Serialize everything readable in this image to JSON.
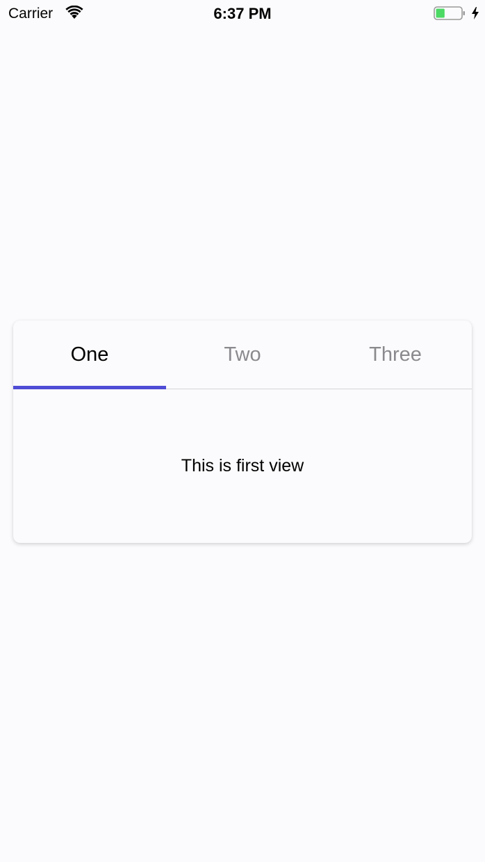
{
  "status_bar": {
    "carrier": "Carrier",
    "time": "6:37 PM",
    "battery_level": 0.35,
    "charging": true,
    "icons": [
      "wifi-icon",
      "battery-icon",
      "charging-bolt-icon"
    ]
  },
  "tabs": {
    "items": [
      {
        "label": "One",
        "active": true
      },
      {
        "label": "Two",
        "active": false
      },
      {
        "label": "Three",
        "active": false
      }
    ],
    "indicator_color": "#4f4cd6",
    "active_color": "#000000",
    "inactive_color": "#8a8a8e"
  },
  "content": {
    "text": "This is first view"
  }
}
